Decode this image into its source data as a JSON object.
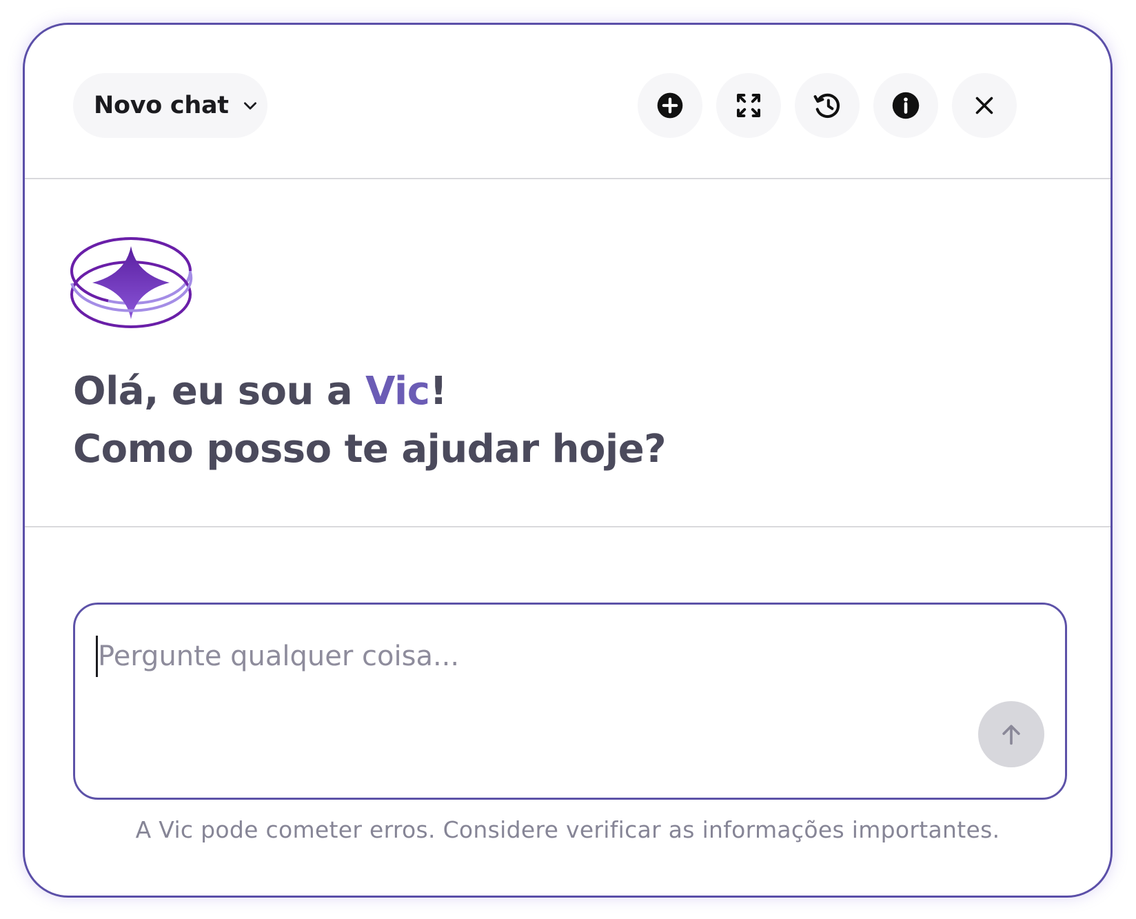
{
  "header": {
    "chat_selector_label": "Novo chat",
    "chat_selector_icon": "chevron-down-icon",
    "buttons": [
      {
        "name": "new-chat-button",
        "icon": "plus-circle-icon"
      },
      {
        "name": "expand-button",
        "icon": "expand-icon"
      },
      {
        "name": "history-button",
        "icon": "history-icon"
      },
      {
        "name": "info-button",
        "icon": "info-icon"
      },
      {
        "name": "close-button",
        "icon": "close-icon"
      }
    ]
  },
  "welcome": {
    "greeting_prefix": "Olá, eu sou a ",
    "assistant_name": "Vic",
    "greeting_suffix": "!",
    "question": "Como posso te ajudar hoje?"
  },
  "composer": {
    "placeholder": "Pergunte qualquer coisa...",
    "value": "",
    "send_icon": "arrow-up-icon"
  },
  "disclaimer": "A Vic pode cometer erros. Considere verificar as informações importantes.",
  "colors": {
    "accent": "#6b5cb5",
    "logo_dark": "#6a1fa8",
    "logo_light": "#a48de6",
    "panel_border": "#5b4fa8",
    "button_bg": "#f6f6f8",
    "send_disabled": "#d7d7dc",
    "text_primary": "#4b4a5c",
    "text_muted": "#868596"
  }
}
